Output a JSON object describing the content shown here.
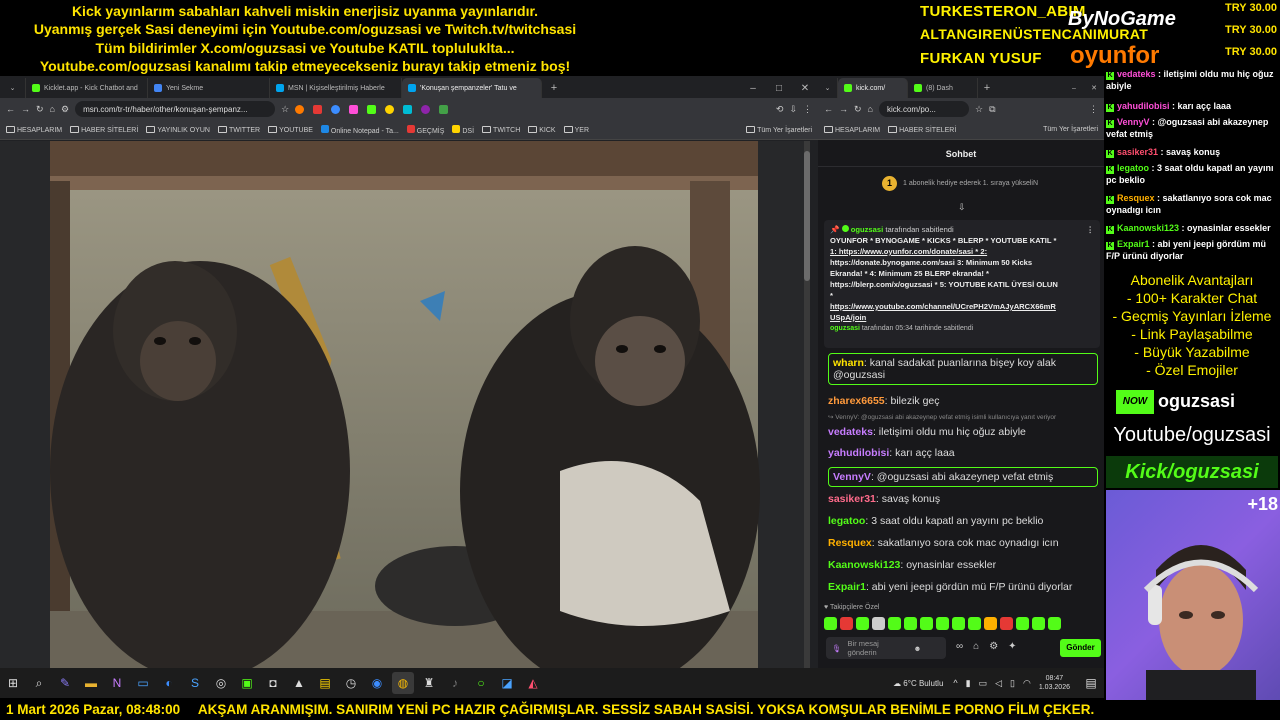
{
  "overlay": {
    "top_lines": [
      "Kick yayınlarım sabahları kahveli miskin enerjisiz uyanma yayınlarıdır.",
      "Uyanmış gerçek Sasi deneyimi için Youtube.com/oguzsasi ve Twitch.tv/twitchsasi",
      "Tüm bildirimler X.com/oguzsasi ve Youtube KATIL topluluklta...",
      "Youtube.com/oguzsasi kanalımı takip etmeyecekseniz burayı takip etmeniz boş!"
    ],
    "donors": [
      "TURKESTERON_ABIM",
      "ALTANGIRENÜSTENCANIMURAT",
      "FURKAN YUSUF"
    ],
    "bynogame": "ByNoGame",
    "oyunfor": "oyunfor",
    "try_amounts": [
      "TRY 30.00",
      "TRY 30.00",
      "TRY 30.00"
    ]
  },
  "left_browser": {
    "tabs": [
      {
        "label": "Kicklet.app - Kick Chatbot and",
        "color": "#53fc18"
      },
      {
        "label": "Yeni Sekme",
        "color": "#4285f4"
      },
      {
        "label": "MSN | Kişiselleştirilmiş Haberle",
        "color": "#00a4ef"
      },
      {
        "label": "'Konuşan şempanzeler' Tatu ve",
        "color": "#00a4ef"
      }
    ],
    "new_tab": "+",
    "url": "msn.com/tr-tr/haber/other/konuşan-şempanz...",
    "bookmarks": [
      "HESAPLARIM",
      "HABER SİTELERİ",
      "YAYINLIK OYUN",
      "TWITTER",
      "YOUTUBE",
      "Online Notepad - Ta...",
      "GEÇMİŞ",
      "DSİ",
      "TWITCH",
      "KICK",
      "YER"
    ],
    "all_bookmarks": "Tüm Yer İşaretleri",
    "window_controls": [
      "–",
      "□",
      "✕"
    ]
  },
  "right_browser": {
    "tabs": [
      {
        "label": "kick.com/",
        "color": "#53fc18"
      },
      {
        "label": "(8) Dash",
        "color": "#53fc18"
      }
    ],
    "url": "kick.com/po...",
    "bookmarks": [
      "HESAPLARIM",
      "HABER SİTELERİ"
    ],
    "all_bookmarks": "Tüm Yer İşaretleri",
    "chat_title": "Sohbet",
    "gift_rank": "1",
    "gift_text": "1 abonelik hediye ederek 1. sıraya yükseliN",
    "pinned": {
      "pinned_by_user": "oguzsasi",
      "pinned_by_suffix": " tarafından sabitlendi",
      "lines": [
        "OYUNFOR * BYNOGAME * KICKS * BLERP * YOUTUBE KATIL *",
        "1: https://www.oyunfor.com/donate/sasi * 2:",
        "https://donate.bynogame.com/sasi 3: Minimum 50 Kicks",
        "Ekranda! * 4: Minimum 25 BLERP ekranda! *",
        "https://blerp.com/x/oguzsasi * 5: YOUTUBE KATIL ÜYESİ OLUN",
        "*",
        "https://www.youtube.com/channel/UCrePH2VmAJyARCX66mR",
        "USpA/join"
      ],
      "footer_user": "oguzsasi",
      "footer_text": " tarafından 05:34 tarihinde sabitlendi"
    },
    "messages": [
      {
        "user": "wharn",
        "color": "#ffe400",
        "text": "kanal sadakat puanlarına bişey koy alak",
        "text2": "@oguzsasi",
        "highlight": true
      },
      {
        "user": "zharex6655",
        "color": "#ff9a3c",
        "text": "bilezik geç"
      },
      {
        "reply": "↪ VennyV: @oguzsasi abi akazeynep vefat etmiş isimli kullanıcıya yanıt veriyor"
      },
      {
        "user": "vedateks",
        "color": "#c77dff",
        "text": "iletişimi oldu mu hiç oğuz abiyle"
      },
      {
        "user": "yahudilobisi",
        "color": "#c77dff",
        "text": "karı açç laaa"
      },
      {
        "user": "VennyV",
        "color": "#c77dff",
        "text": "@oguzsasi abi akazeynep vefat etmiş",
        "highlight": true
      },
      {
        "user": "sasiker31",
        "color": "#ff6b8b",
        "text": "savaş konuş"
      },
      {
        "user": "legatoo",
        "color": "#53fc18",
        "text": "3 saat oldu kapatl an yayını pc beklio"
      },
      {
        "user": "Resquex",
        "color": "#ffb000",
        "text": "sakatlanıyo sora cok mac oynadıgı icın"
      },
      {
        "user": "Kaanowski123",
        "color": "#53fc18",
        "text": "oynasinlar essekler"
      },
      {
        "user": "Expair1",
        "color": "#53fc18",
        "text": "abi yeni jeepi gördün mü F/P ürünü diyorlar"
      }
    ],
    "followers_special": "Takipçilere Özel",
    "input_placeholder": "Bir mesaj gönderin",
    "send_label": "Gönder"
  },
  "side_chat": [
    {
      "user": "vedateks",
      "color": "#ff4fd8",
      "text": "iletişimi oldu mu hiç oğuz abiyle"
    },
    {
      "user": "yahudilobisi",
      "color": "#ff4fd8",
      "text": "karı açç laaa"
    },
    {
      "user": "VennyV",
      "color": "#ff4fd8",
      "text": "@oguzsasi abi akazeynep vefat etmiş"
    },
    {
      "user": "sasiker31",
      "color": "#ff4f6f",
      "text": "savaş konuş"
    },
    {
      "user": "legatoo",
      "color": "#53fc18",
      "text": "3 saat oldu kapatl an yayını pc beklio"
    },
    {
      "user": "Resquex",
      "color": "#ffb000",
      "text": "sakatlanıyo sora cok mac oynadıgı icın"
    },
    {
      "user": "Kaanowski123",
      "color": "#53fc18",
      "text": "oynasinlar essekler"
    },
    {
      "user": "Expair1",
      "color": "#53fc18",
      "text": "abi yeni jeepi gördüm mü F/P ürünü diyorlar"
    }
  ],
  "perks": {
    "title": "Abonelik Avantajları",
    "items": [
      "- 100+ Karakter Chat",
      "- Geçmiş Yayınları İzleme",
      "- Link Paylaşabilme",
      "- Büyük Yazabilme",
      "- Özel Emojiler"
    ]
  },
  "channel": {
    "now_logo": "NOW",
    "name": "oguzsasi",
    "youtube": "Youtube/oguzsasi",
    "kick": "Kick/oguzsasi",
    "age_badge": "+18"
  },
  "taskbar": {
    "weather": "6°C  Bulutlu",
    "time": "08:47",
    "date": "1.03.2026"
  },
  "ticker": {
    "date_time": "1 Mart 2026 Pazar, 08:48:00",
    "message": "AKŞAM ARANMIŞIM. SANIRIM YENİ PC HAZIR ÇAĞIRMIŞLAR. SESSİZ SABAH SASİSİ. YOKSA KOMŞULAR BENİMLE PORNO FİLM ÇEKER."
  },
  "colors": {
    "kick_green": "#53fc18",
    "overlay_yellow": "#ffe400",
    "chat_bg": "#18181b"
  }
}
